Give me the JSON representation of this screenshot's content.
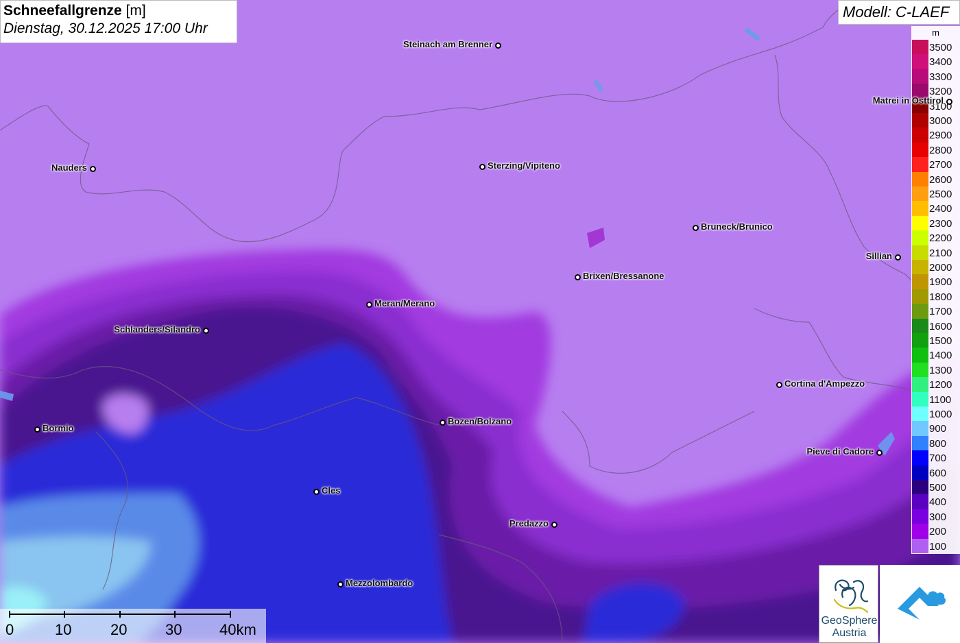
{
  "title": {
    "main": "Schneefallgrenze",
    "unit": "[m]",
    "date": "Dienstag, 30.12.2025 17:00 Uhr"
  },
  "model": "Modell: C-LAEF",
  "legend": {
    "unit": "m",
    "levels": [
      {
        "label": "3500",
        "color": "#c8105a"
      },
      {
        "label": "3400",
        "color": "#d0107a"
      },
      {
        "label": "3300",
        "color": "#b80a78"
      },
      {
        "label": "3200",
        "color": "#9a0a6e"
      },
      {
        "label": "3100",
        "color": "#880000"
      },
      {
        "label": "3000",
        "color": "#b00000"
      },
      {
        "label": "2900",
        "color": "#cc0000"
      },
      {
        "label": "2800",
        "color": "#e80000"
      },
      {
        "label": "2700",
        "color": "#ff2020"
      },
      {
        "label": "2600",
        "color": "#ff7f00"
      },
      {
        "label": "2500",
        "color": "#ff9f10"
      },
      {
        "label": "2400",
        "color": "#ffbf00"
      },
      {
        "label": "2300",
        "color": "#ffff00"
      },
      {
        "label": "2200",
        "color": "#ccff00"
      },
      {
        "label": "2100",
        "color": "#c8dc00"
      },
      {
        "label": "2000",
        "color": "#c8b400"
      },
      {
        "label": "1900",
        "color": "#c09600"
      },
      {
        "label": "1800",
        "color": "#a09a00"
      },
      {
        "label": "1700",
        "color": "#6e9a10"
      },
      {
        "label": "1600",
        "color": "#1a8a1a"
      },
      {
        "label": "1500",
        "color": "#10a010"
      },
      {
        "label": "1400",
        "color": "#10c010"
      },
      {
        "label": "1300",
        "color": "#20e020"
      },
      {
        "label": "1200",
        "color": "#30f080"
      },
      {
        "label": "1100",
        "color": "#30ffc0"
      },
      {
        "label": "1000",
        "color": "#70ffff"
      },
      {
        "label": "900",
        "color": "#70c8ff"
      },
      {
        "label": "800",
        "color": "#3080ff"
      },
      {
        "label": "700",
        "color": "#0000ff"
      },
      {
        "label": "600",
        "color": "#0000c0"
      },
      {
        "label": "500",
        "color": "#2a0080"
      },
      {
        "label": "400",
        "color": "#5a00c0"
      },
      {
        "label": "300",
        "color": "#7a00e0"
      },
      {
        "label": "200",
        "color": "#a000e8"
      },
      {
        "label": "100",
        "color": "#b060f0"
      }
    ]
  },
  "cities": [
    {
      "name": "Steinach am Brenner",
      "side": "left"
    },
    {
      "name": "Nauders",
      "side": "left"
    },
    {
      "name": "Sterzing/Vipiteno",
      "side": "right"
    },
    {
      "name": "Matrei in Osttirol",
      "side": "left"
    },
    {
      "name": "Bruneck/Brunico",
      "side": "right"
    },
    {
      "name": "Sillian",
      "side": "left"
    },
    {
      "name": "Brixen/Bressanone",
      "side": "right"
    },
    {
      "name": "Meran/Merano",
      "side": "right"
    },
    {
      "name": "Schlanders/Silandro",
      "side": "left"
    },
    {
      "name": "Cortina d'Ampezzo",
      "side": "right"
    },
    {
      "name": "Bormio",
      "side": "right"
    },
    {
      "name": "Bozen/Bolzano",
      "side": "right"
    },
    {
      "name": "Pieve di Cadore",
      "side": "left"
    },
    {
      "name": "Cles",
      "side": "right"
    },
    {
      "name": "Predazzo",
      "side": "left"
    },
    {
      "name": "Mezzolombardo",
      "side": "right"
    }
  ],
  "scale": {
    "labels": [
      "0",
      "10",
      "20",
      "30",
      "40km"
    ]
  },
  "logos": {
    "geosphere_line1": "GeoSphere",
    "geosphere_line2": "Austria"
  }
}
